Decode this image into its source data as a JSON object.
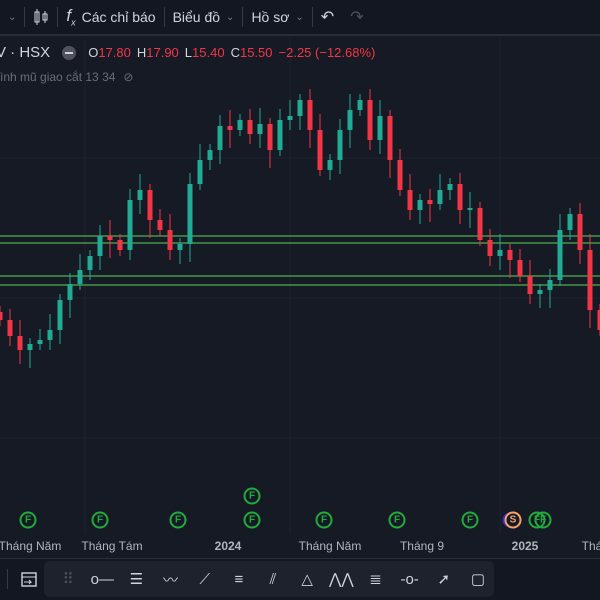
{
  "toolbar": {
    "indicators_label": "Các chỉ báo",
    "chart_label": "Biểu đồ",
    "profile_label": "Hồ sơ"
  },
  "legend": {
    "symbol": "V · HSX",
    "o_label": "O",
    "o": "17.80",
    "h_label": "H",
    "h": "17.90",
    "l_label": "L",
    "l": "15.40",
    "c_label": "C",
    "c": "15.50",
    "change": "−2.25 (−12.68%)"
  },
  "study": {
    "label": "ình mũ giao cắt 13 34"
  },
  "time_axis": [
    "Tháng Năm",
    "Tháng Tám",
    "2024",
    "Tháng Năm",
    "Tháng 9",
    "2025",
    "Thá"
  ],
  "events": [
    {
      "letter": "F"
    },
    {
      "letter": "F"
    },
    {
      "letter": "F"
    },
    {
      "letter": "F"
    },
    {
      "letter": "F"
    },
    {
      "letter": "F"
    },
    {
      "letter": "F"
    },
    {
      "letter": "F"
    },
    {
      "letter": "S"
    },
    {
      "letter": "F"
    },
    {
      "letter": "F"
    }
  ],
  "colors": {
    "up": "#22ab94",
    "down": "#f23645",
    "level": "#4caf50",
    "bg": "#161a25"
  },
  "chart_data": {
    "type": "candlestick",
    "closes": [
      14.0,
      13.2,
      12.5,
      12.8,
      13.0,
      13.5,
      15.0,
      15.8,
      16.5,
      17.2,
      18.2,
      18.0,
      17.5,
      20.0,
      20.5,
      19.0,
      18.5,
      17.5,
      17.8,
      20.8,
      22.0,
      22.5,
      23.7,
      23.5,
      24.0,
      23.3,
      23.8,
      22.5,
      24.0,
      24.2,
      25.0,
      23.5,
      21.5,
      22.0,
      23.5,
      24.5,
      25.0,
      23.0,
      24.2,
      22.0,
      20.5,
      19.5,
      20.0,
      19.8,
      20.5,
      20.8,
      19.5,
      19.6,
      18.0,
      17.2,
      17.5,
      17.0,
      16.2,
      15.3,
      15.5,
      16.0,
      18.5,
      19.3,
      17.5,
      14.5,
      13.5
    ],
    "levels": [
      18.2,
      17.85,
      16.2,
      15.75
    ],
    "ylim": [
      3,
      27
    ]
  }
}
